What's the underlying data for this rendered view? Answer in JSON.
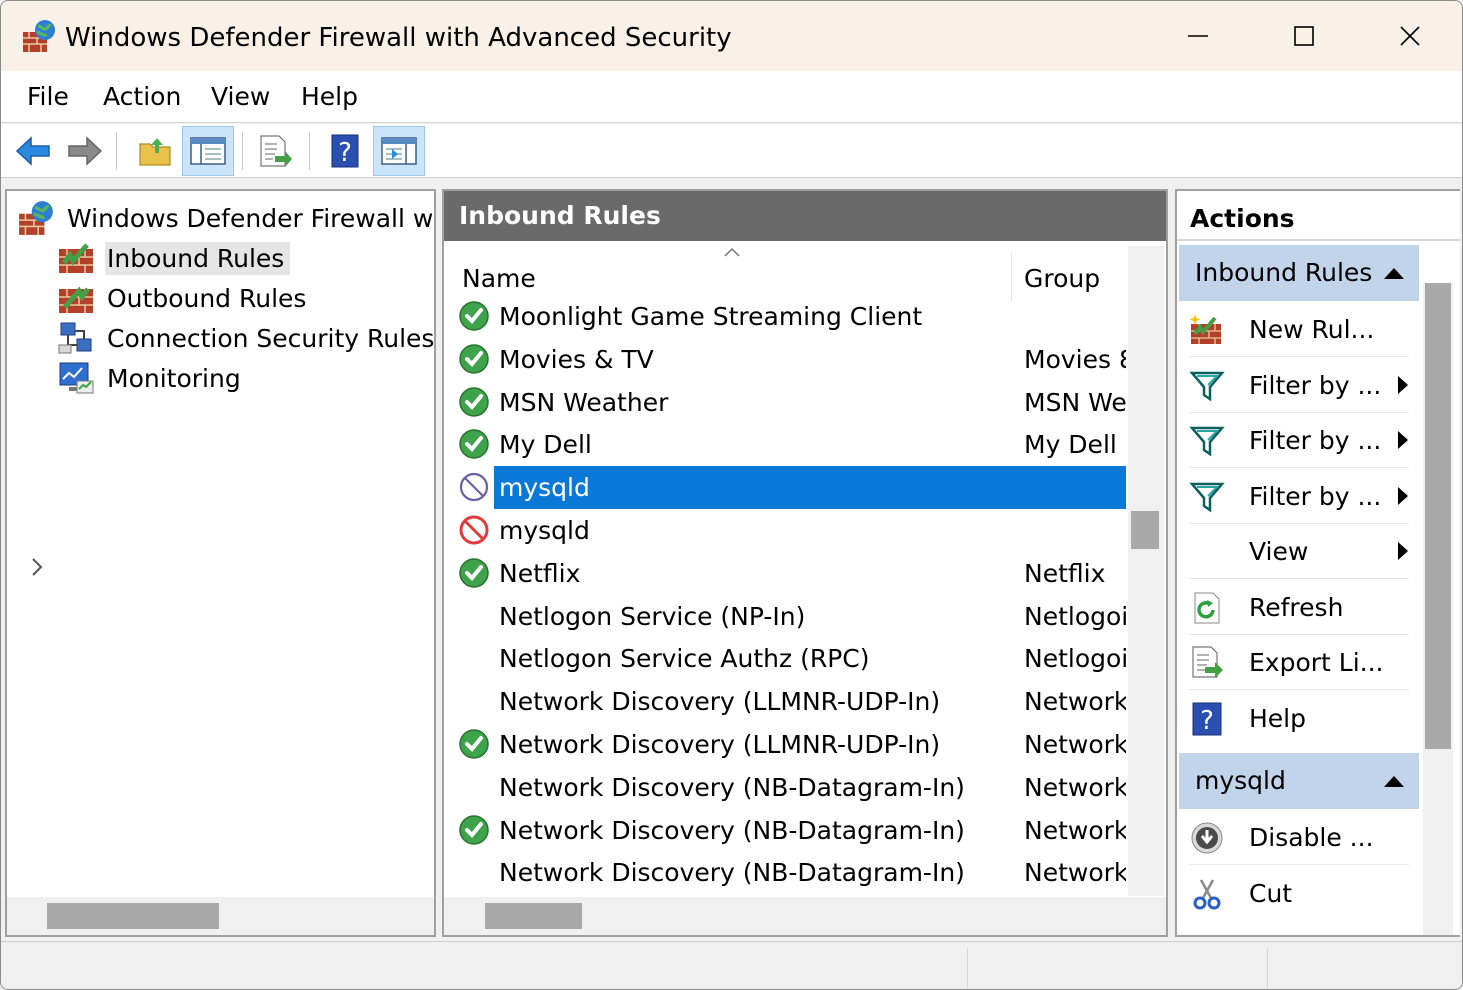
{
  "window": {
    "title": "Windows Defender Firewall with Advanced Security",
    "app_icon": "firewall-globe-icon",
    "controls": [
      "minimize-icon",
      "maximize-icon",
      "close-icon"
    ]
  },
  "menubar": {
    "items": [
      "File",
      "Action",
      "View",
      "Help"
    ]
  },
  "toolbar": {
    "buttons": [
      {
        "icon": "back-arrow-icon"
      },
      {
        "icon": "forward-arrow-icon"
      },
      {
        "icon": "up-folder-icon"
      },
      {
        "icon": "show-hide-console-tree-icon",
        "pressed": true
      },
      {
        "icon": "export-list-icon"
      },
      {
        "icon": "help-icon"
      },
      {
        "icon": "show-hide-action-pane-icon",
        "pressed": true
      }
    ]
  },
  "tree": {
    "root": "Windows Defender Firewall with",
    "items": [
      {
        "label": "Inbound Rules",
        "icon": "inbound-rules-icon",
        "selected": true
      },
      {
        "label": "Outbound Rules",
        "icon": "outbound-rules-icon"
      },
      {
        "label": "Connection Security Rules",
        "icon": "connection-security-icon"
      },
      {
        "label": "Monitoring",
        "icon": "monitoring-icon",
        "expandable": true
      }
    ]
  },
  "center": {
    "header": "Inbound Rules",
    "columns": {
      "name": "Name",
      "group": "Group"
    },
    "rows": [
      {
        "name": "Moonlight Game Streaming Client",
        "group": "",
        "status": "enabled"
      },
      {
        "name": "Movies & TV",
        "group": "Movies 8",
        "status": "enabled"
      },
      {
        "name": "MSN Weather",
        "group": "MSN We",
        "status": "enabled"
      },
      {
        "name": "My Dell",
        "group": "My Dell",
        "status": "enabled"
      },
      {
        "name": "mysqld",
        "group": "",
        "status": "block-disabled",
        "selected": true
      },
      {
        "name": "mysqld",
        "group": "",
        "status": "block"
      },
      {
        "name": "Netflix",
        "group": "Netflix",
        "status": "enabled"
      },
      {
        "name": "Netlogon Service (NP-In)",
        "group": "Netlogoi",
        "status": "none"
      },
      {
        "name": "Netlogon Service Authz (RPC)",
        "group": "Netlogoi",
        "status": "none"
      },
      {
        "name": "Network Discovery (LLMNR-UDP-In)",
        "group": "Network",
        "status": "none"
      },
      {
        "name": "Network Discovery (LLMNR-UDP-In)",
        "group": "Network",
        "status": "enabled"
      },
      {
        "name": "Network Discovery (NB-Datagram-In)",
        "group": "Network",
        "status": "none"
      },
      {
        "name": "Network Discovery (NB-Datagram-In)",
        "group": "Network",
        "status": "enabled"
      },
      {
        "name": "Network Discovery (NB-Datagram-In)",
        "group": "Network",
        "status": "none"
      }
    ]
  },
  "actions": {
    "header": "Actions",
    "section1": "Inbound Rules",
    "items1": [
      {
        "label": "New Rul...",
        "icon": "new-rule-icon"
      },
      {
        "label": "Filter by ...",
        "icon": "filter-icon",
        "submenu": true
      },
      {
        "label": "Filter by ...",
        "icon": "filter-icon",
        "submenu": true
      },
      {
        "label": "Filter by ...",
        "icon": "filter-icon",
        "submenu": true
      },
      {
        "label": "View",
        "icon": "",
        "submenu": true
      },
      {
        "label": "Refresh",
        "icon": "refresh-icon"
      },
      {
        "label": "Export Li...",
        "icon": "export-list-icon"
      },
      {
        "label": "Help",
        "icon": "help-icon"
      }
    ],
    "section2": "mysqld",
    "items2": [
      {
        "label": "Disable ...",
        "icon": "disable-icon"
      },
      {
        "label": "Cut",
        "icon": "cut-icon"
      }
    ]
  }
}
